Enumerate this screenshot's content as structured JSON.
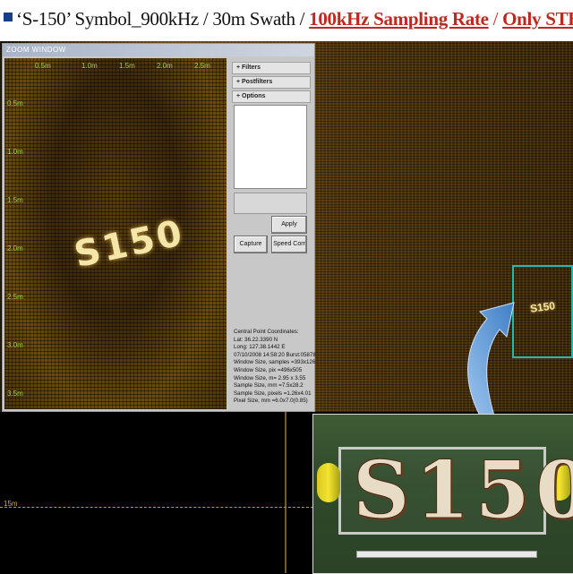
{
  "slide": {
    "title_part1": "‘S-150’ Symbol_900kHz / 30m Swath / ",
    "title_part2": "100kHz Sampling Rate",
    "title_sep": " / ",
    "title_part3": "Only STBD"
  },
  "zoom_window": {
    "title": "ZOOM WINDOW",
    "x_axis_labels": [
      "0.5m",
      "1.0m",
      "1.5m",
      "2.0m",
      "2.5m"
    ],
    "y_axis_labels": [
      "0.5m",
      "1.0m",
      "1.5m",
      "2.0m",
      "2.5m",
      "3.0m",
      "3.5m"
    ],
    "symbol_text": "S150"
  },
  "panel": {
    "filters_label": "Filters",
    "postfilters_label": "Postfilters",
    "options_label": "Options",
    "apply_label": "Apply",
    "capture_label": "Capture",
    "speed_corr_label": "Speed Corr"
  },
  "info": {
    "heading": "Central Point Coordinates:",
    "lat": "Lat:      36.22.3390 N",
    "long": "Long:   127.38.1442 E",
    "datetime": "07/10/2008 14:58:20 Burst:05878",
    "window_samples": "Window Size, samples =393x126",
    "window_pix": "Window Size, pix =496x505",
    "window_m": "Window Size, m= 2.95 x 3.55",
    "sample_mm": "Sample Size, mm =7.5x28.2",
    "sample_pixels": "Sample Size, pixels =1.26x4.01",
    "pixel_mm": "Pixel Size, mm =6.0x7.0(0.85)"
  },
  "display": {
    "range_label": "15m",
    "highlight_symbol": "S150"
  },
  "photo": {
    "letters": "S150"
  },
  "colors": {
    "title_red": "#c0271e",
    "bullet": "#1a3c8c",
    "axis_label": "#9bd040",
    "highlight": "#25b8b0",
    "arrow": "#4f8fd0"
  }
}
